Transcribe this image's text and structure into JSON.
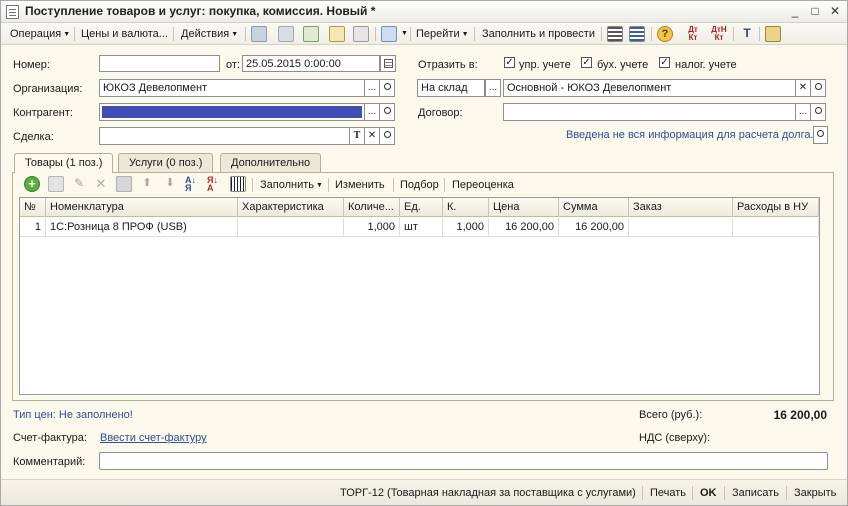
{
  "window": {
    "title": "Поступление товаров и услуг: покупка, комиссия. Новый *",
    "minimize": "_",
    "maximize": "□",
    "close": "✕"
  },
  "toolbar": {
    "operation": "Операция",
    "prices_currency": "Цены и валюта...",
    "actions": "Действия",
    "goto": "Перейти",
    "fill_and_post": "Заполнить и провести",
    "help": "?",
    "dt_kt": "Дт Кт",
    "dt_kt_n": "ДтН Кт"
  },
  "header": {
    "number_label": "Номер:",
    "number_value": "",
    "from_label": "от:",
    "date_value": "25.05.2015  0:00:00",
    "reflect_label": "Отразить в:",
    "reflect_mgmt": "упр. учете",
    "reflect_acc": "бух. учете",
    "reflect_tax": "налог. учете",
    "org_label": "Организация:",
    "org_value": "ЮКОЗ Девелопмент",
    "warehouse_type": "На склад",
    "warehouse_value": "Основной - ЮКОЗ Девелопмент",
    "counterparty_label": "Контрагент:",
    "counterparty_value": "",
    "contract_label": "Договор:",
    "contract_value": "",
    "deal_label": "Сделка:",
    "deal_value": "",
    "debt_info": "Введена не вся информация для расчета долга.",
    "dots": "...",
    "t_btn": "T",
    "x_btn": "✕"
  },
  "tabs": [
    {
      "label": "Товары (1 поз.)"
    },
    {
      "label": "Услуги (0 поз.)"
    },
    {
      "label": "Дополнительно"
    }
  ],
  "table_toolbar": {
    "fill": "Заполнить",
    "change": "Изменить",
    "select": "Подбор",
    "revalue": "Переоценка"
  },
  "table": {
    "columns": [
      "№",
      "Номенклатура",
      "Характеристика",
      "Количе...",
      "Ед.",
      "К.",
      "Цена",
      "Сумма",
      "Заказ",
      "Расходы в НУ"
    ],
    "rows": [
      {
        "n": "1",
        "item": "1С:Розница 8 ПРОФ (USB)",
        "characteristic": "",
        "qty": "1,000",
        "unit": "шт",
        "k": "1,000",
        "price": "16 200,00",
        "sum": "16 200,00",
        "order": "",
        "nu_expenses": ""
      }
    ]
  },
  "footer": {
    "price_type": "Тип цен: Не заполнено!",
    "total_label": "Всего (руб.):",
    "total_value": "16 200,00",
    "invoice_label": "Счет-фактура:",
    "invoice_link": "Ввести счет-фактуру",
    "vat_label": "НДС (сверху):",
    "vat_value": "",
    "comment_label": "Комментарий:",
    "comment_value": ""
  },
  "bottom_bar": {
    "torg12": "ТОРГ-12 (Товарная накладная за поставщика с услугами)",
    "print": "Печать",
    "ok": "OK",
    "save": "Записать",
    "close": "Закрыть"
  },
  "colors": {
    "counterparty_selection": "#3f4fb5",
    "link": "#2d4f96",
    "form_background": "#fbf8ec"
  }
}
